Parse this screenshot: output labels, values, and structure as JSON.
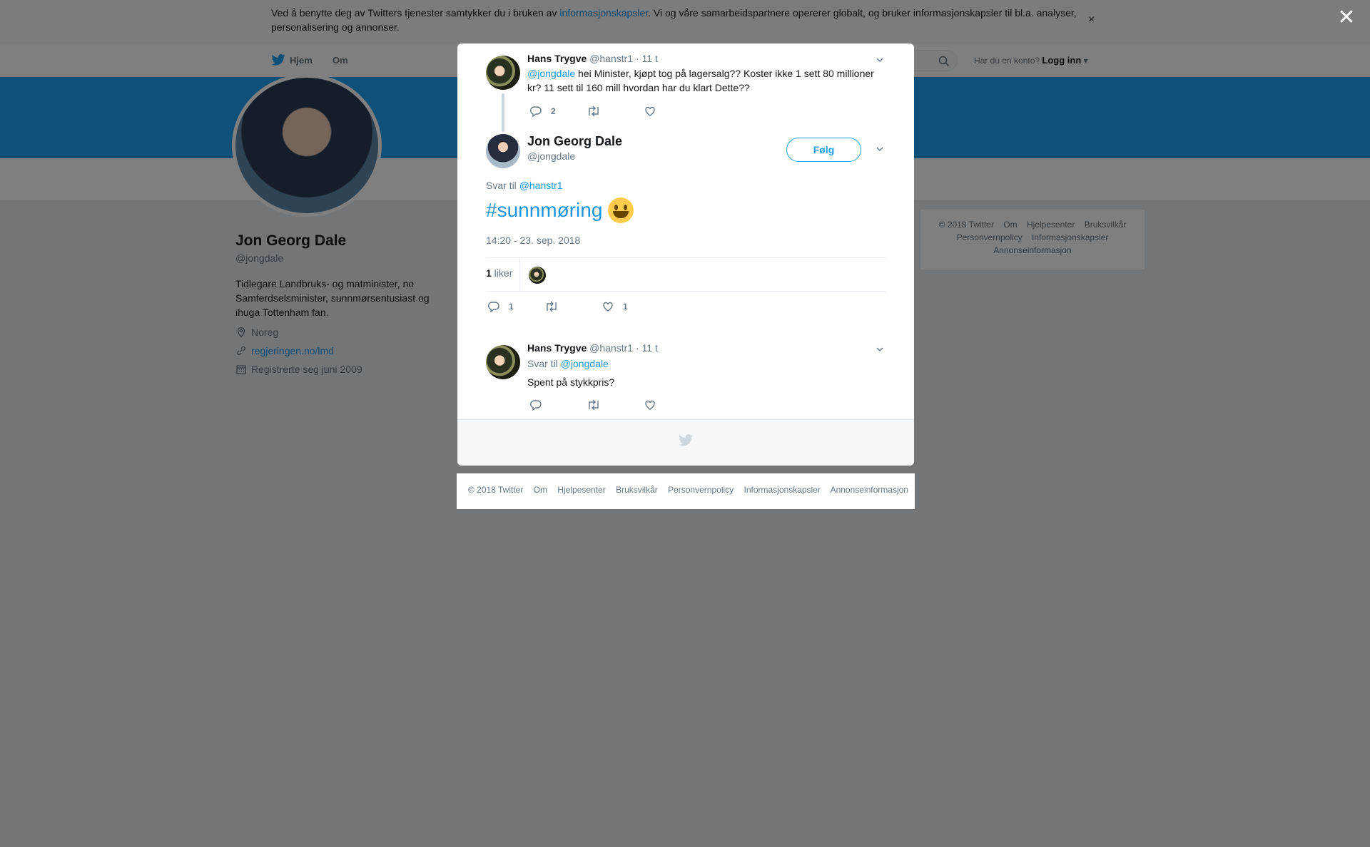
{
  "cookie_bar": {
    "text_before": "Ved å benytte deg av Twitters tjenester samtykker du i bruken av ",
    "link": "informasjonskapsler",
    "text_after": ". Vi og våre samarbeidspartnere opererer globalt, og bruker informasjonskapsler til bl.a. analyser, personalisering og annonser.",
    "close": "×"
  },
  "top_nav": {
    "home": "Hjem",
    "about": "Om",
    "login_prompt": "Har du en konto?",
    "login_label": "Logg inn"
  },
  "profile": {
    "name": "Jon Georg Dale",
    "handle": "@jongdale",
    "bio": "Tidlegare Landbruks- og matminister, no Samferdselsminister, sunnmørsentusiast og ihuga Tottenham fan.",
    "location": "Noreg",
    "website": "regjeringen.no/lmd",
    "joined": "Registrerte seg juni 2009"
  },
  "side_footer": {
    "items": [
      "© 2018 Twitter",
      "Om",
      "Hjelpesenter",
      "Bruksvilkår",
      "Personvernpolicy",
      "Informasjonskapsler",
      "Annonseinformasjon"
    ]
  },
  "overlay": {
    "close": "✕"
  },
  "parent_tweet": {
    "name": "Hans Trygve",
    "handle": "@hanstr1",
    "time": "· 11 t",
    "mention": "@jongdale",
    "text": " hei Minister, kjøpt tog på lagersalg?? Koster ikke 1 sett 80 millioner kr? 11 sett til 160 mill hvordan har du klart Dette??",
    "reply_count": "2"
  },
  "main_tweet": {
    "name": "Jon Georg Dale",
    "handle": "@jongdale",
    "follow": "Følg",
    "reply_to_label": "Svar til ",
    "reply_to": "@hanstr1",
    "hashtag": "#sunnmøring",
    "timestamp": "14:20 - 23. sep. 2018",
    "likes_count": "1",
    "likes_label": " liker",
    "reply_count": "1",
    "like_count": "1"
  },
  "reply_tweet": {
    "name": "Hans Trygve",
    "handle": "@hanstr1",
    "time": "· 11 t",
    "reply_to_label": "Svar til ",
    "reply_to": "@jongdale",
    "text": "Spent på stykkpris?"
  },
  "page_footer": {
    "items": [
      "© 2018 Twitter",
      "Om",
      "Hjelpesenter",
      "Bruksvilkår",
      "Personvernpolicy",
      "Informasjonskapsler",
      "Annonseinformasjon"
    ]
  },
  "colors": {
    "accent": "#1da1f2",
    "link": "#1b95e0",
    "muted": "#657786"
  }
}
